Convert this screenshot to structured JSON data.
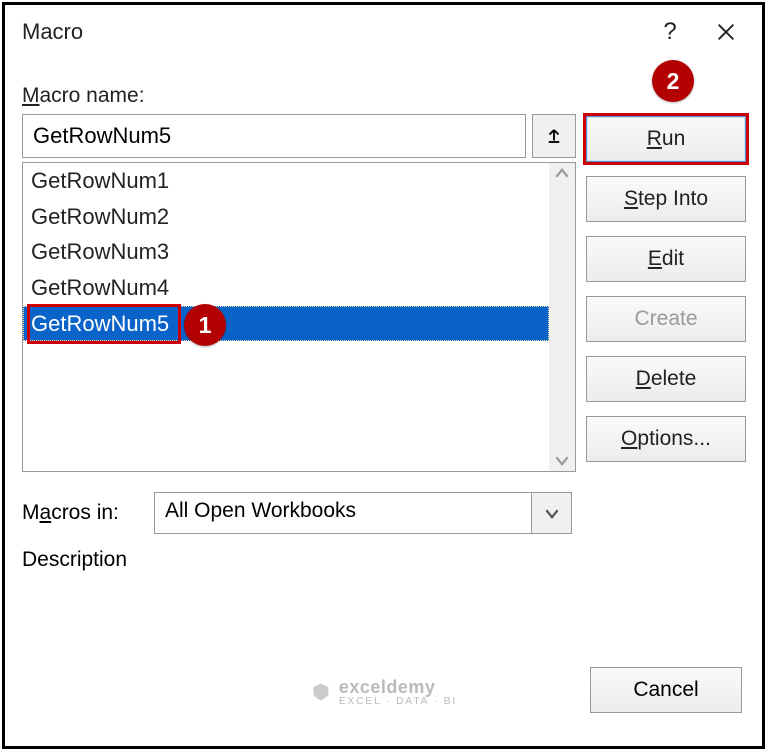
{
  "dialog": {
    "title": "Macro",
    "help_icon": "?",
    "close_icon": "✕"
  },
  "labels": {
    "macro_name": "Macro name:",
    "macros_in": "Macros in:",
    "description": "Description"
  },
  "macro_name_value": "GetRowNum5",
  "list": {
    "items": [
      "GetRowNum1",
      "GetRowNum2",
      "GetRowNum3",
      "GetRowNum4",
      "GetRowNum5"
    ],
    "selected_index": 4
  },
  "buttons": {
    "run": "Run",
    "step_into": "Step Into",
    "edit": "Edit",
    "create": "Create",
    "delete": "Delete",
    "options": "Options...",
    "cancel": "Cancel"
  },
  "macros_in_value": "All Open Workbooks",
  "annotations": {
    "badge1": "1",
    "badge2": "2"
  },
  "watermark": {
    "name": "exceldemy",
    "tagline": "EXCEL · DATA · BI"
  }
}
